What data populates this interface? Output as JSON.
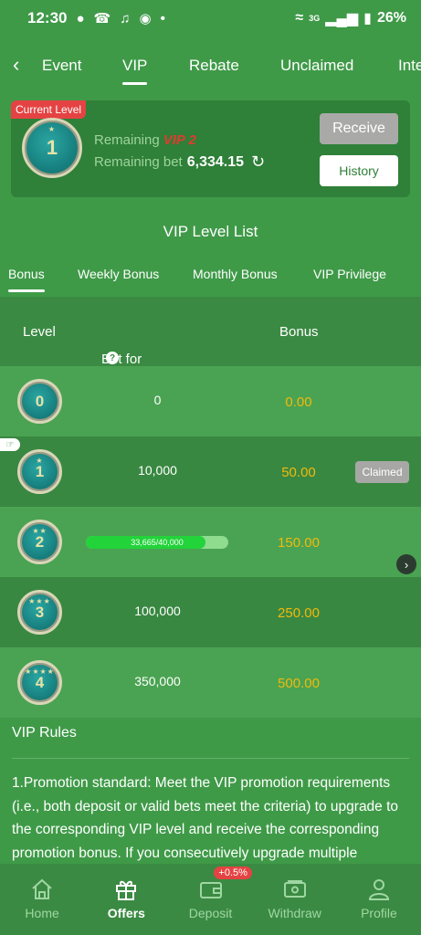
{
  "status_bar": {
    "time": "12:30",
    "battery": "26%",
    "network": "3G"
  },
  "tabs": [
    {
      "label": "Event"
    },
    {
      "label": "VIP"
    },
    {
      "label": "Rebate"
    },
    {
      "label": "Unclaimed"
    },
    {
      "label": "Inte"
    }
  ],
  "current": {
    "badge": "Current Level",
    "level": "1",
    "remaining_label": "Remaining",
    "remaining_vip": "VIP 2",
    "remaining_bet_label": "Remaining bet",
    "remaining_bet": "6,334.15",
    "receive_label": "Receive",
    "history_label": "History"
  },
  "list_title": "VIP Level List",
  "sub_tabs": [
    {
      "label": "Bonus"
    },
    {
      "label": "Weekly Bonus"
    },
    {
      "label": "Monthly Bonus"
    },
    {
      "label": "VIP Privilege"
    }
  ],
  "table": {
    "headers": {
      "level": "Level",
      "bet": "Bet for promotion",
      "bonus": "Bonus"
    },
    "rows": [
      {
        "level": "0",
        "bet": "0",
        "bonus": "0.00"
      },
      {
        "level": "1",
        "bet": "10,000",
        "bonus": "50.00",
        "status": "Claimed"
      },
      {
        "level": "2",
        "progress_text": "33,665/40,000",
        "progress": 0.8416,
        "bonus": "150.00"
      },
      {
        "level": "3",
        "bet": "100,000",
        "bonus": "250.00"
      },
      {
        "level": "4",
        "bet": "350,000",
        "bonus": "500.00"
      }
    ]
  },
  "rules": {
    "title": "VIP Rules",
    "text": "1.Promotion standard: Meet the VIP promotion requirements (i.e., both deposit or valid bets meet the criteria) to upgrade to the corresponding VIP level and receive the corresponding promotion bonus. If you consecutively upgrade multiple"
  },
  "bottom_nav": [
    {
      "label": "Home",
      "icon": "home-icon"
    },
    {
      "label": "Offers",
      "icon": "gift-icon"
    },
    {
      "label": "Deposit",
      "icon": "wallet-icon",
      "badge": "+0.5%"
    },
    {
      "label": "Withdraw",
      "icon": "withdraw-icon"
    },
    {
      "label": "Profile",
      "icon": "profile-icon"
    }
  ],
  "colors": {
    "background": "#3f9a48",
    "accent_gold": "#f2b90c",
    "badge_red": "#e54343",
    "vip_red": "#e33a2f",
    "progress": "#22d33a"
  }
}
